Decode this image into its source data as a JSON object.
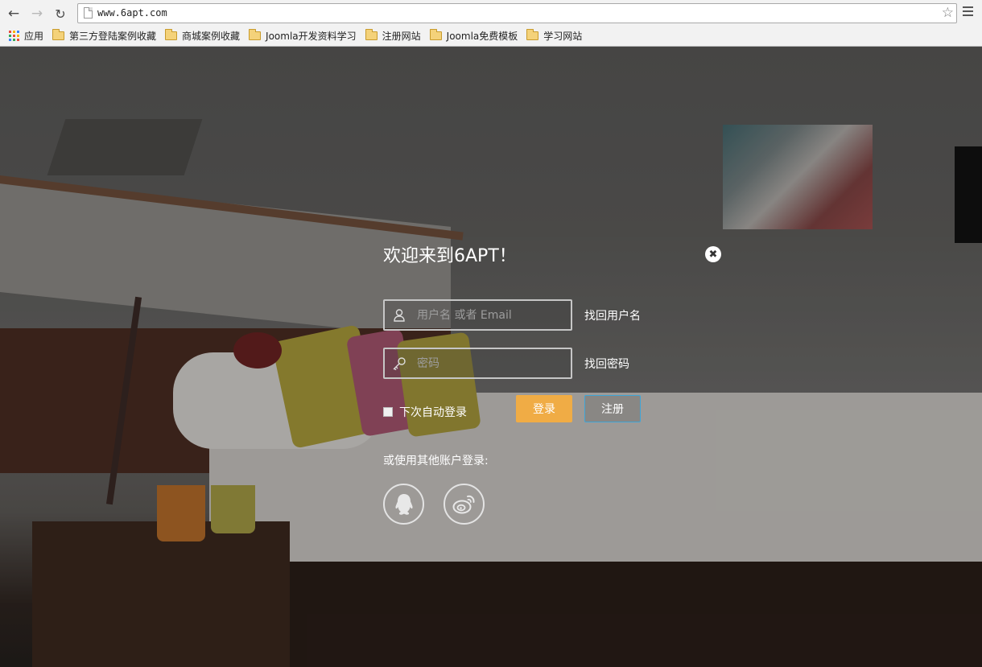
{
  "browser": {
    "url": "www.6apt.com",
    "bookmarks": [
      {
        "label": "应用",
        "icon": "apps-grid-icon"
      },
      {
        "label": "第三方登陆案例收藏",
        "icon": "folder-icon"
      },
      {
        "label": "商城案例收藏",
        "icon": "folder-icon"
      },
      {
        "label": "Joomla开发资料学习",
        "icon": "folder-icon"
      },
      {
        "label": "注册网站",
        "icon": "folder-icon"
      },
      {
        "label": "Joomla免费模板",
        "icon": "folder-icon"
      },
      {
        "label": "学习网站",
        "icon": "folder-icon"
      }
    ]
  },
  "login": {
    "title": "欢迎来到6APT！",
    "username_placeholder": "用户名 或者 Email",
    "password_placeholder": "密码",
    "find_username": "找回用户名",
    "find_password": "找回密码",
    "remember_label": "下次自动登录",
    "login_button": "登录",
    "register_button": "注册",
    "other_login": "或使用其他账户登录:",
    "social": [
      {
        "name": "qq-icon"
      },
      {
        "name": "weibo-icon"
      }
    ]
  },
  "colors": {
    "login_button": "#f0ac45",
    "register_border": "#3fa5d6"
  }
}
